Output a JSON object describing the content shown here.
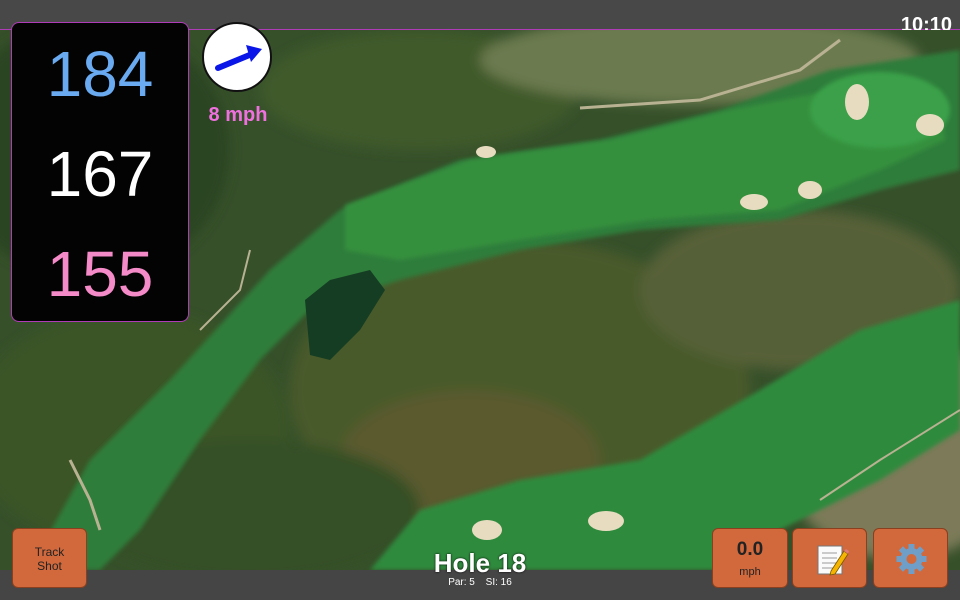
{
  "status": {
    "time": "10:10"
  },
  "distances": {
    "back": "184",
    "middle": "167",
    "front": "155"
  },
  "wind": {
    "speed": "8 mph",
    "direction_icon": "wind-arrow-icon",
    "arrow_color": "#0a16e8"
  },
  "hole": {
    "title": "Hole 18",
    "par": "Par: 5",
    "si": "SI: 16"
  },
  "buttons": {
    "track_line1": "Track",
    "track_line2": "Shot",
    "speed_value": "0.0",
    "speed_unit": "mph",
    "notes_icon": "notepad-icon",
    "settings_icon": "gear-icon"
  },
  "colors": {
    "back": "#6aaaf0",
    "middle": "#ffffff",
    "front": "#f58ac8",
    "button": "#d1693c",
    "accent": "#b03bb8"
  }
}
